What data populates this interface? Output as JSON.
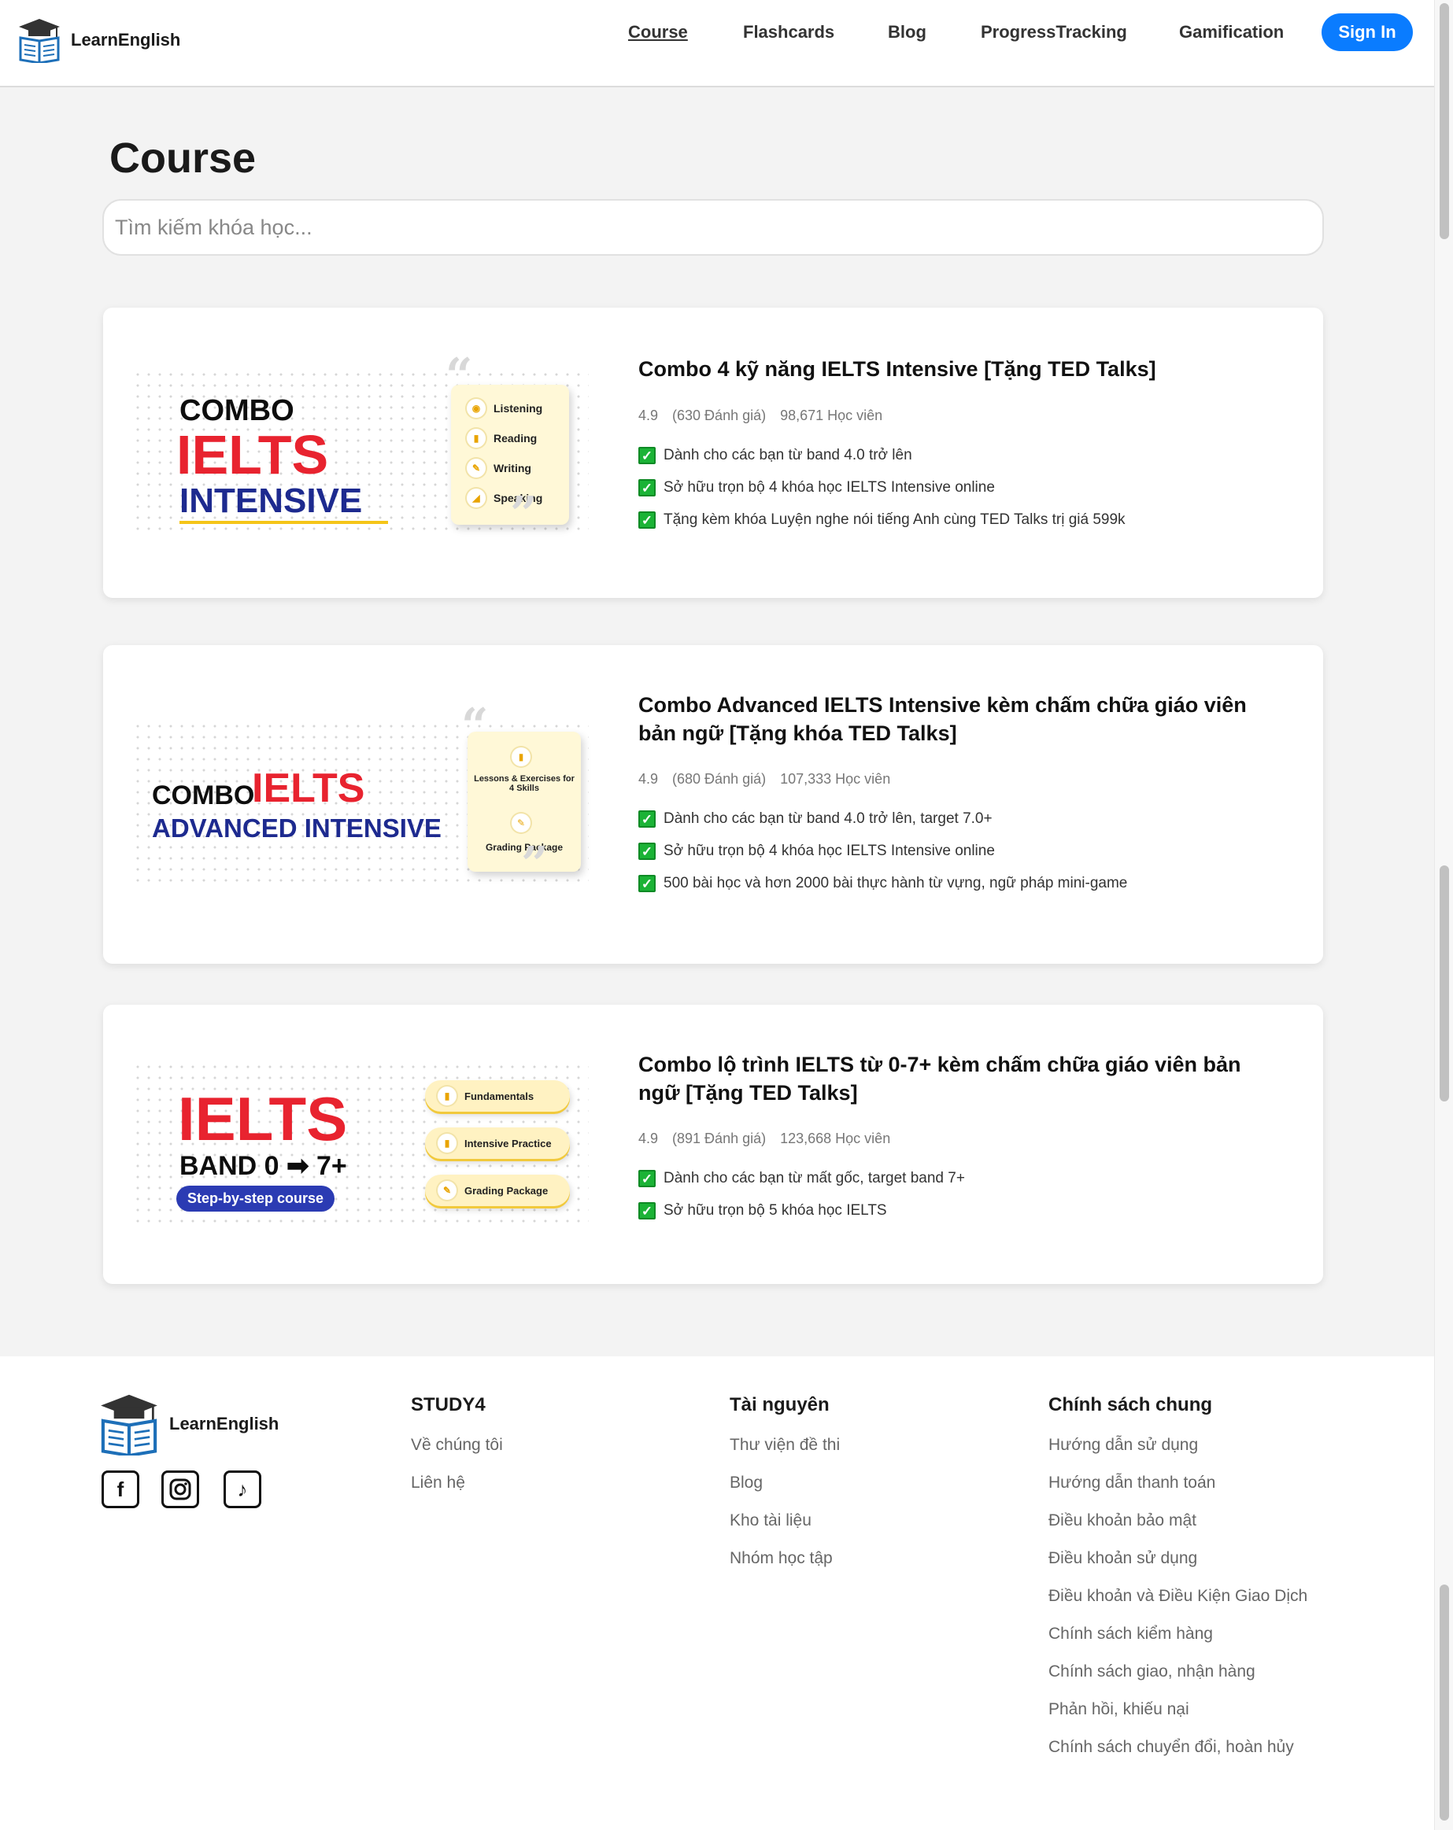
{
  "header": {
    "logo_text": "LearnEnglish",
    "nav": [
      "Course",
      "Flashcards",
      "Blog",
      "ProgressTracking",
      "Gamification"
    ],
    "signin_label": "Sign In"
  },
  "main": {
    "title": "Course",
    "search_placeholder": "Tìm kiếm khóa học..."
  },
  "courses": [
    {
      "title": "Combo 4 kỹ năng IELTS Intensive [Tặng TED Talks]",
      "rating": "4.9",
      "reviews": "(630 Đánh giá)",
      "students": "98,671 Học viên",
      "features": [
        "Dành cho các bạn từ band 4.0 trở lên",
        "Sở hữu trọn bộ 4 khóa học IELTS Intensive online",
        "Tặng kèm khóa Luyện nghe nói tiếng Anh cùng TED Talks trị giá 599k"
      ],
      "thumb": {
        "line1": "COMBO",
        "line2": "IELTS",
        "line3": "INTENSIVE",
        "items": [
          "Listening",
          "Reading",
          "Writing",
          "Speaking"
        ]
      }
    },
    {
      "title": "Combo Advanced IELTS Intensive kèm chấm chữa giáo viên bản ngữ [Tặng khóa TED Talks]",
      "rating": "4.9",
      "reviews": "(680 Đánh giá)",
      "students": "107,333 Học viên",
      "features": [
        "Dành cho các bạn từ band 4.0 trở lên, target 7.0+",
        "Sở hữu trọn bộ 4 khóa học IELTS Intensive online",
        "500 bài học và hơn 2000 bài thực hành từ vựng, ngữ pháp mini-game"
      ],
      "thumb": {
        "line1": "COMBO",
        "line2": "IELTS",
        "line3": "ADVANCED INTENSIVE",
        "items": [
          "Lessons & Exercises for 4 Skills",
          "Grading Package"
        ]
      }
    },
    {
      "title": "Combo lộ trình IELTS từ 0-7+ kèm chấm chữa giáo viên bản ngữ [Tặng TED Talks]",
      "rating": "4.9",
      "reviews": "(891 Đánh giá)",
      "students": "123,668 Học viên",
      "features": [
        "Dành cho các bạn từ mất gốc, target band 7+",
        "Sở hữu trọn bộ 5 khóa học IELTS"
      ],
      "thumb": {
        "line1": "IELTS",
        "line2": "BAND 0 ➡ 7+",
        "line3": "Step-by-step course",
        "items": [
          "Fundamentals",
          "Intensive Practice",
          "Grading Package"
        ]
      }
    }
  ],
  "footer": {
    "logo_text": "LearnEnglish",
    "col1": {
      "title": "STUDY4",
      "links": [
        "Về chúng tôi",
        "Liên hệ"
      ]
    },
    "col2": {
      "title": "Tài nguyên",
      "links": [
        "Thư viện đề thi",
        "Blog",
        "Kho tài liệu",
        "Nhóm học tập"
      ]
    },
    "col3": {
      "title": "Chính sách chung",
      "links": [
        "Hướng dẫn sử dụng",
        "Hướng dẫn thanh toán",
        "Điều khoản bảo mật",
        "Điều khoản sử dụng",
        "Điều khoản và Điều Kiện Giao Dịch",
        "Chính sách kiểm hàng",
        "Chính sách giao, nhận hàng",
        "Phản hồi, khiếu nại",
        "Chính sách chuyển đổi, hoàn hủy"
      ]
    }
  },
  "icons": {
    "social": [
      "facebook-icon",
      "instagram-icon",
      "tiktok-icon"
    ],
    "check": "check-icon"
  },
  "colors": {
    "accent": "#0a7cff",
    "check": "#1bb336",
    "ielts_red": "#e8232f",
    "navy": "#1d2a8f"
  }
}
